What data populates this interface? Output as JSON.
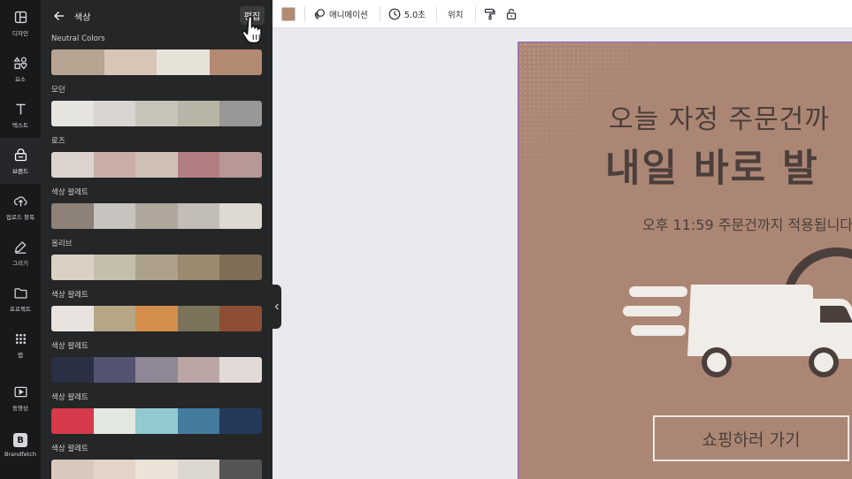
{
  "rail": {
    "items": [
      {
        "label": "디자인",
        "icon": "layout-icon"
      },
      {
        "label": "요소",
        "icon": "shapes-icon"
      },
      {
        "label": "텍스트",
        "icon": "text-icon"
      },
      {
        "label": "브랜드",
        "icon": "brand-icon"
      },
      {
        "label": "업로드 항목",
        "icon": "upload-icon"
      },
      {
        "label": "그리기",
        "icon": "draw-icon"
      },
      {
        "label": "프로젝트",
        "icon": "folder-icon"
      },
      {
        "label": "앱",
        "icon": "apps-icon"
      },
      {
        "label": "동영상",
        "icon": "video-icon"
      },
      {
        "label": "Brandfetch",
        "icon": "brandfetch-icon",
        "logo_letter": "B"
      }
    ]
  },
  "panel": {
    "title": "색상",
    "edit_label": "편집",
    "palettes": [
      {
        "name": "Neutral Colors",
        "colors": [
          "#b7a392",
          "#d9c5b8",
          "#e7e2d7",
          "#b38a72"
        ]
      },
      {
        "name": "모던",
        "colors": [
          "#e6e4df",
          "#dad5d1",
          "#c7c3b8",
          "#b9b5a6",
          "#999896"
        ]
      },
      {
        "name": "로즈",
        "colors": [
          "#dcd3cf",
          "#c8aea7",
          "#cfc0b5",
          "#b17f81",
          "#b89797"
        ]
      },
      {
        "name": "색상 팔레트",
        "colors": [
          "#8d8178",
          "#c7c3be",
          "#b0a69c",
          "#c2bdb7",
          "#dedad2"
        ]
      },
      {
        "name": "올리브",
        "colors": [
          "#dad1c4",
          "#c4bfaa",
          "#ada08a",
          "#9b8a6f",
          "#7f6d55"
        ]
      },
      {
        "name": "색상 팔레트",
        "colors": [
          "#e8e3de",
          "#b6a685",
          "#d38e4b",
          "#7b7359",
          "#8e4e35"
        ]
      },
      {
        "name": "색상 팔레트",
        "colors": [
          "#2b2f43",
          "#525470",
          "#908796",
          "#bba6a5",
          "#e2dad6"
        ]
      },
      {
        "name": "색상 팔레트",
        "colors": [
          "#d63a4b",
          "#e2e7df",
          "#92c9cf",
          "#457b9d",
          "#25395a"
        ]
      },
      {
        "name": "색상 팔레트",
        "colors": [
          "#d9c8bc",
          "#e3d4c8",
          "#ece2d8",
          "#dcd8d1",
          "#555555"
        ]
      }
    ]
  },
  "toolbar": {
    "color": "#b38a72",
    "animation_label": "애니메이션",
    "duration_label": "5.0초",
    "position_label": "위치"
  },
  "design": {
    "background": "#ac8674",
    "line1": "오늘 자정 주문건까",
    "line2": "내일 바로 발",
    "subtitle": "오후 11:59 주문건까지 적용됩니다",
    "button_label": "쇼핑하러 가기"
  }
}
